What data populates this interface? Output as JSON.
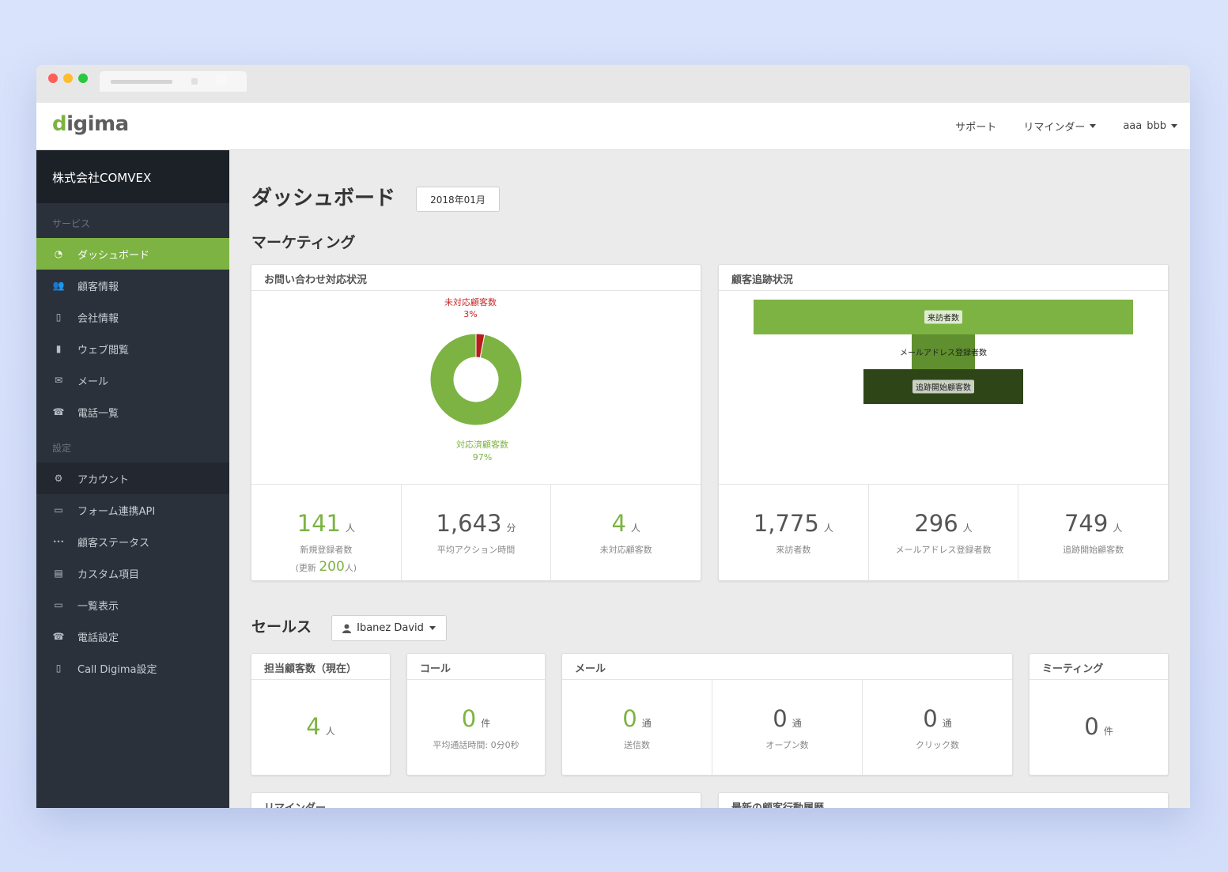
{
  "brand": {
    "logo_text_accent": "d",
    "logo_text_rest": "igima"
  },
  "topbar": {
    "support": "サポート",
    "reminder": "リマインダー",
    "user_first": "aaa",
    "user_last": "bbb"
  },
  "sidebar": {
    "company": "株式会社COMVEX",
    "service_label": "サービス",
    "service_items": [
      {
        "label": "ダッシュボード",
        "icon": "dashboard-icon"
      },
      {
        "label": "顧客情報",
        "icon": "users-icon"
      },
      {
        "label": "会社情報",
        "icon": "building-icon"
      },
      {
        "label": "ウェブ閲覧",
        "icon": "bar-chart-icon"
      },
      {
        "label": "メール",
        "icon": "envelope-icon"
      },
      {
        "label": "電話一覧",
        "icon": "phone-icon"
      }
    ],
    "settings_label": "設定",
    "settings_items": [
      {
        "label": "アカウント",
        "icon": "gear-icon"
      },
      {
        "label": "フォーム連携API",
        "icon": "form-icon"
      },
      {
        "label": "顧客ステータス",
        "icon": "ellipsis-icon"
      },
      {
        "label": "カスタム項目",
        "icon": "document-icon"
      },
      {
        "label": "一覧表示",
        "icon": "monitor-icon"
      },
      {
        "label": "電話設定",
        "icon": "phone-icon"
      },
      {
        "label": "Call Digima設定",
        "icon": "mobile-icon"
      }
    ]
  },
  "main": {
    "title": "ダッシュボード",
    "month": "2018年01月",
    "marketing_title": "マーケティング",
    "sales_title": "セールス",
    "sales_user": "Ibanez David"
  },
  "inquiry_panel": {
    "title": "お問い合わせ対応状況",
    "stats": [
      {
        "value": "141",
        "unit": "人",
        "label": "新規登録者数",
        "sub_prefix": "(更新 ",
        "sub_value": "200",
        "sub_suffix": "人)"
      },
      {
        "value": "1,643",
        "unit": "分",
        "label": "平均アクション時間"
      },
      {
        "value": "4",
        "unit": "人",
        "label": "未対応顧客数"
      }
    ]
  },
  "tracking_panel": {
    "title": "顧客追跡状況",
    "stats": [
      {
        "value": "1,775",
        "unit": "人",
        "label": "来訪者数"
      },
      {
        "value": "296",
        "unit": "人",
        "label": "メールアドレス登録者数"
      },
      {
        "value": "749",
        "unit": "人",
        "label": "追跡開始顧客数"
      }
    ]
  },
  "sales_panels": {
    "customers": {
      "title": "担当顧客数（現在）",
      "value": "4",
      "unit": "人"
    },
    "call": {
      "title": "コール",
      "value": "0",
      "unit": "件",
      "label": "平均通話時間: 0分0秒"
    },
    "mail": {
      "title": "メール",
      "items": [
        {
          "value": "0",
          "unit": "通",
          "label": "送信数"
        },
        {
          "value": "0",
          "unit": "通",
          "label": "オープン数"
        },
        {
          "value": "0",
          "unit": "通",
          "label": "クリック数"
        }
      ]
    },
    "meeting": {
      "title": "ミーティング",
      "value": "0",
      "unit": "件"
    }
  },
  "bottom_panels": {
    "left_title": "リマインダー",
    "right_title": "最新の顧客行動履歴"
  },
  "chart_data": [
    {
      "type": "pie",
      "donut": true,
      "slices": [
        {
          "label": "対応済顧客数",
          "percent_label": "97%",
          "value": 97,
          "color": "#7cb342"
        },
        {
          "label": "未対応顧客数",
          "percent_label": "3%",
          "value": 3,
          "color": "#b71c1c"
        }
      ]
    },
    {
      "type": "bar",
      "orientation": "funnel",
      "categories": [
        "来訪者数",
        "メールアドレス登録者数",
        "追跡開始顧客数"
      ],
      "values": [
        1775,
        296,
        749
      ],
      "colors": [
        "#7cb342",
        "#5f8f2e",
        "#2e4617"
      ]
    }
  ]
}
